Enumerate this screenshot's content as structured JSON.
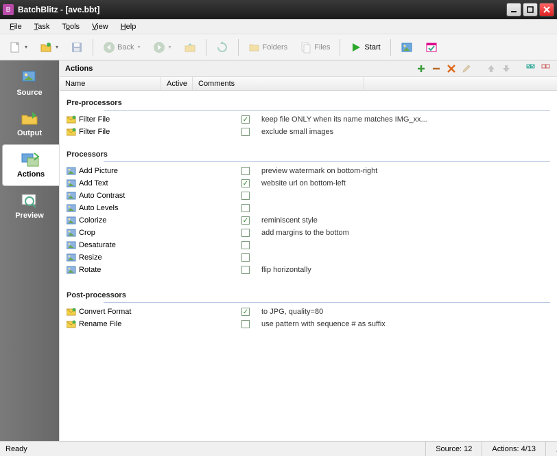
{
  "title": "BatchBlitz - [ave.bbt]",
  "menu": [
    "File",
    "Task",
    "Tools",
    "View",
    "Help"
  ],
  "toolbar": {
    "new_label": "",
    "back_label": "Back",
    "folders_label": "Folders",
    "files_label": "Files",
    "start_label": "Start"
  },
  "sidebar": {
    "items": [
      {
        "label": "Source"
      },
      {
        "label": "Output"
      },
      {
        "label": "Actions"
      },
      {
        "label": "Preview"
      }
    ]
  },
  "panel": {
    "title": "Actions"
  },
  "columns": {
    "name": "Name",
    "active": "Active",
    "comments": "Comments"
  },
  "groups": [
    {
      "title": "Pre-processors",
      "rows": [
        {
          "icon": "env",
          "name": "Filter File",
          "active": true,
          "comment": "keep file ONLY when its name matches IMG_xx..."
        },
        {
          "icon": "env",
          "name": "Filter File",
          "active": false,
          "comment": "exclude small images"
        }
      ]
    },
    {
      "title": "Processors",
      "rows": [
        {
          "icon": "img",
          "name": "Add Picture",
          "active": false,
          "comment": "preview watermark on bottom-right"
        },
        {
          "icon": "img",
          "name": "Add Text",
          "active": true,
          "comment": "website url on bottom-left"
        },
        {
          "icon": "img",
          "name": "Auto Contrast",
          "active": false,
          "comment": ""
        },
        {
          "icon": "img",
          "name": "Auto Levels",
          "active": false,
          "comment": ""
        },
        {
          "icon": "img",
          "name": "Colorize",
          "active": true,
          "comment": "reminiscent style"
        },
        {
          "icon": "img",
          "name": "Crop",
          "active": false,
          "comment": "add margins to the bottom"
        },
        {
          "icon": "img",
          "name": "Desaturate",
          "active": false,
          "comment": ""
        },
        {
          "icon": "img",
          "name": "Resize",
          "active": false,
          "comment": ""
        },
        {
          "icon": "img",
          "name": "Rotate",
          "active": false,
          "comment": "flip horizontally"
        }
      ]
    },
    {
      "title": "Post-processors",
      "rows": [
        {
          "icon": "env",
          "name": "Convert Format",
          "active": true,
          "comment": "to JPG, quality=80"
        },
        {
          "icon": "env",
          "name": "Rename File",
          "active": false,
          "comment": "use pattern with sequence # as suffix"
        }
      ]
    }
  ],
  "status": {
    "ready": "Ready",
    "source": "Source: 12",
    "actions": "Actions: 4/13"
  }
}
